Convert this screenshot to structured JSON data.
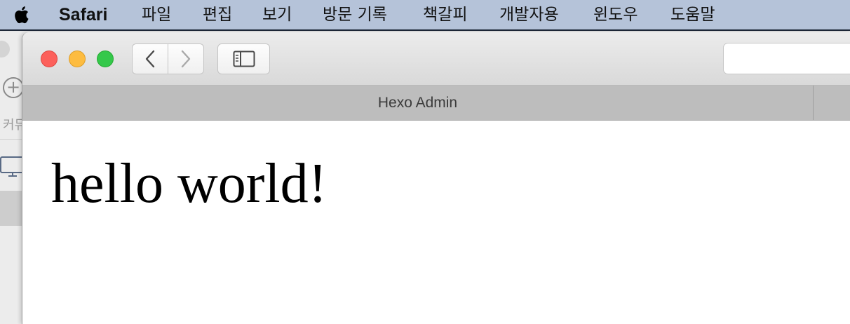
{
  "menubar": {
    "app_name": "Safari",
    "items": [
      "파일",
      "편집",
      "보기",
      "방문 기록",
      "책갈피",
      "개발자용",
      "윈도우",
      "도움말"
    ]
  },
  "background_window": {
    "label": "커뮤"
  },
  "browser": {
    "tab_title": "Hexo Admin",
    "address": ""
  },
  "page": {
    "heading": "hello world!"
  },
  "colors": {
    "menubar_bg": "#b5c3d9",
    "close": "#fc605b",
    "minimize": "#fdbc40",
    "maximize": "#34c84a",
    "tabbar_bg": "#bdbdbd"
  },
  "icons": [
    "apple-icon",
    "back-chevron-icon",
    "forward-chevron-icon",
    "sidebar-icon",
    "add-icon",
    "monitor-icon"
  ]
}
